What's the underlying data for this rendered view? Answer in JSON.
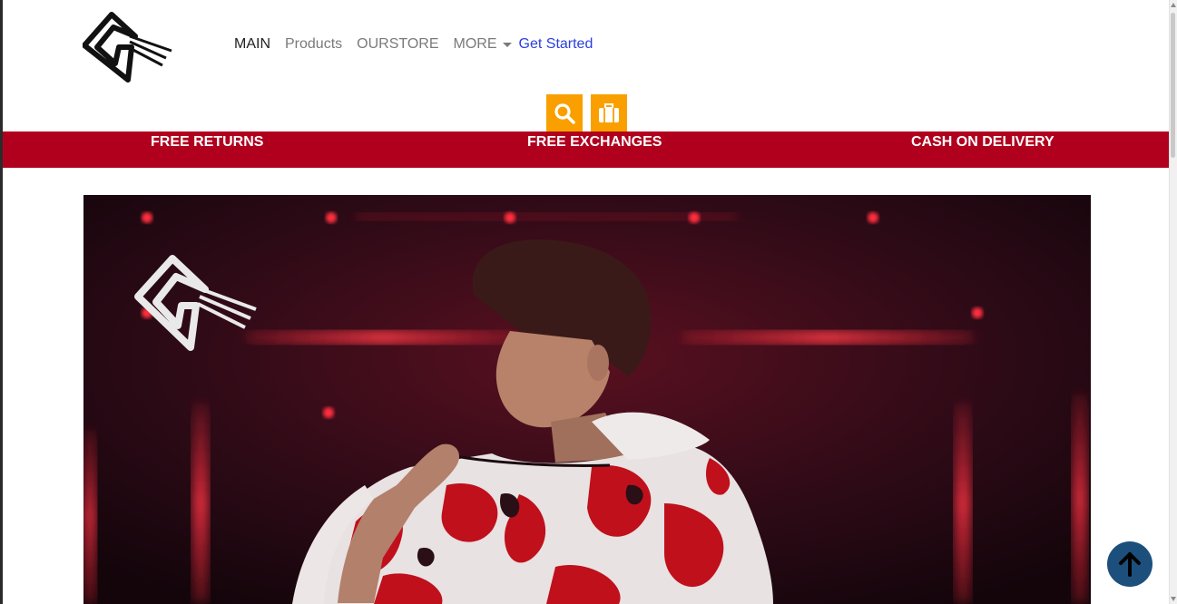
{
  "nav": {
    "items": [
      {
        "label": "MAIN"
      },
      {
        "label": "Products"
      },
      {
        "label": "OURSTORE"
      }
    ],
    "more_label": "MORE",
    "cta_label": "Get Started"
  },
  "icons": {
    "search": "search-icon",
    "bag": "suitcase-icon",
    "to_top": "arrow-up-icon"
  },
  "promo": {
    "items": [
      {
        "label": "FREE RETURNS"
      },
      {
        "label": "FREE EXCHANGES"
      },
      {
        "label": "CASH ON DELIVERY"
      }
    ]
  },
  "colors": {
    "accent": "#f9a000",
    "promo_bar": "#b0001e",
    "cta_link": "#2a3fe0",
    "to_top_button": "#1d4f7c"
  }
}
